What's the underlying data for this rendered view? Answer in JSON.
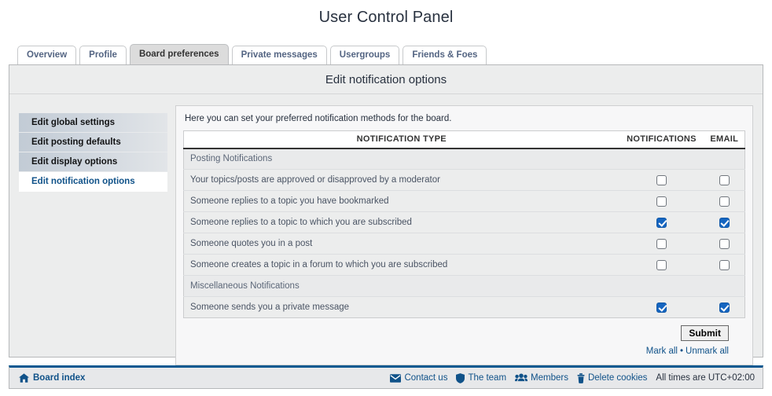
{
  "page": {
    "title": "User Control Panel"
  },
  "tabs": [
    {
      "label": "Overview",
      "active": false
    },
    {
      "label": "Profile",
      "active": false
    },
    {
      "label": "Board preferences",
      "active": true
    },
    {
      "label": "Private messages",
      "active": false
    },
    {
      "label": "Usergroups",
      "active": false
    },
    {
      "label": "Friends & Foes",
      "active": false
    }
  ],
  "panel": {
    "heading": "Edit notification options",
    "intro": "Here you can set your preferred notification methods for the board."
  },
  "sidebar": {
    "items": [
      {
        "label": "Edit global settings",
        "active": false
      },
      {
        "label": "Edit posting defaults",
        "active": false
      },
      {
        "label": "Edit display options",
        "active": false
      },
      {
        "label": "Edit notification options",
        "active": true
      }
    ]
  },
  "table": {
    "headers": {
      "type": "NOTIFICATION TYPE",
      "notifications": "NOTIFICATIONS",
      "email": "EMAIL"
    },
    "rows": [
      {
        "kind": "group",
        "label": "Posting Notifications"
      },
      {
        "kind": "option",
        "label": "Your topics/posts are approved or disapproved by a moderator",
        "notifications": false,
        "email": false
      },
      {
        "kind": "option",
        "label": "Someone replies to a topic you have bookmarked",
        "notifications": false,
        "email": false
      },
      {
        "kind": "option",
        "label": "Someone replies to a topic to which you are subscribed",
        "notifications": true,
        "email": true
      },
      {
        "kind": "option",
        "label": "Someone quotes you in a post",
        "notifications": false,
        "email": false
      },
      {
        "kind": "option",
        "label": "Someone creates a topic in a forum to which you are subscribed",
        "notifications": false,
        "email": false
      },
      {
        "kind": "group",
        "label": "Miscellaneous Notifications"
      },
      {
        "kind": "option",
        "label": "Someone sends you a private message",
        "notifications": true,
        "email": true
      }
    ]
  },
  "actions": {
    "submit_label": "Submit",
    "mark_all": "Mark all",
    "separator": "•",
    "unmark_all": "Unmark all"
  },
  "footer": {
    "board_index": "Board index",
    "links": [
      {
        "label": "Contact us",
        "icon": "envelope-icon"
      },
      {
        "label": "The team",
        "icon": "shield-icon"
      },
      {
        "label": "Members",
        "icon": "people-icon"
      },
      {
        "label": "Delete cookies",
        "icon": "trash-icon"
      }
    ],
    "timezone": "All times are UTC+02:00"
  },
  "colors": {
    "accent": "#105289",
    "checkbox_checked": "#1565c0",
    "panel_bg": "#eceded",
    "footer_rule": "#0a5991"
  }
}
